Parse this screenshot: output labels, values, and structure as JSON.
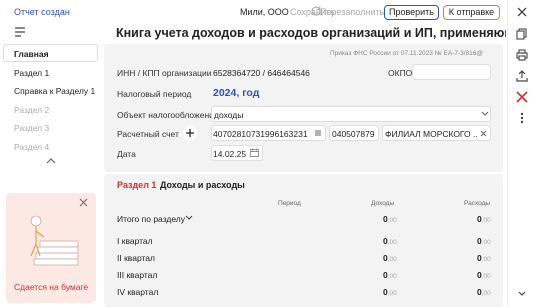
{
  "topbar": {
    "status": "Отчет создан",
    "org": "Мили, ООО",
    "save": "Сохранить",
    "refill": "Перезаполнить",
    "check": "Проверить",
    "send": "К отправке"
  },
  "title": "Книга учета доходов и расходов организаций и ИП, применяющих У...",
  "order": "Приказ ФНС России от 07.11.2023 № ЕА-7-3/816@",
  "sidebar": {
    "items": [
      {
        "label": "Главная"
      },
      {
        "label": "Раздел 1"
      },
      {
        "label": "Справка к Разделу 1"
      },
      {
        "label": "Раздел 2"
      },
      {
        "label": "Раздел 3"
      },
      {
        "label": "Раздел 4"
      }
    ]
  },
  "promo": {
    "label": "Сдается на бумаге"
  },
  "form": {
    "inn_label": "ИНН / КПП организации",
    "inn_value": "6528364720 / 646464546",
    "okpo_label": "ОКПО",
    "period_label": "Налоговый период",
    "period_value": "2024, год",
    "object_label": "Объект налогообложения",
    "object_value": "доходы",
    "account_label": "Расчетный счет",
    "account_value": "40702810731996163231",
    "bik_value": "040507879",
    "bank_value": "ФИЛИАЛ МОРСКОГО ...",
    "date_label": "Дата",
    "date_value": "14.02.25"
  },
  "section": {
    "num": "Раздел 1",
    "title": "Доходы и расходы",
    "col_period": "Период",
    "col_income": "Доходы",
    "col_expense": "Расходы",
    "rows": [
      {
        "label": "Итого по разделу",
        "income": "0",
        "income_dec": ",00",
        "expense": "0",
        "expense_dec": ",00"
      },
      {
        "label": "I квартал",
        "income": "0",
        "income_dec": ",00",
        "expense": "0",
        "expense_dec": ",00"
      },
      {
        "label": "II квартал",
        "income": "0",
        "income_dec": ",00",
        "expense": "0",
        "expense_dec": ",00"
      },
      {
        "label": "III квартал",
        "income": "0",
        "income_dec": ",00",
        "expense": "0",
        "expense_dec": ",00"
      },
      {
        "label": "IV квартал",
        "income": "0",
        "income_dec": ",00",
        "expense": "0",
        "expense_dec": ",00"
      }
    ]
  }
}
